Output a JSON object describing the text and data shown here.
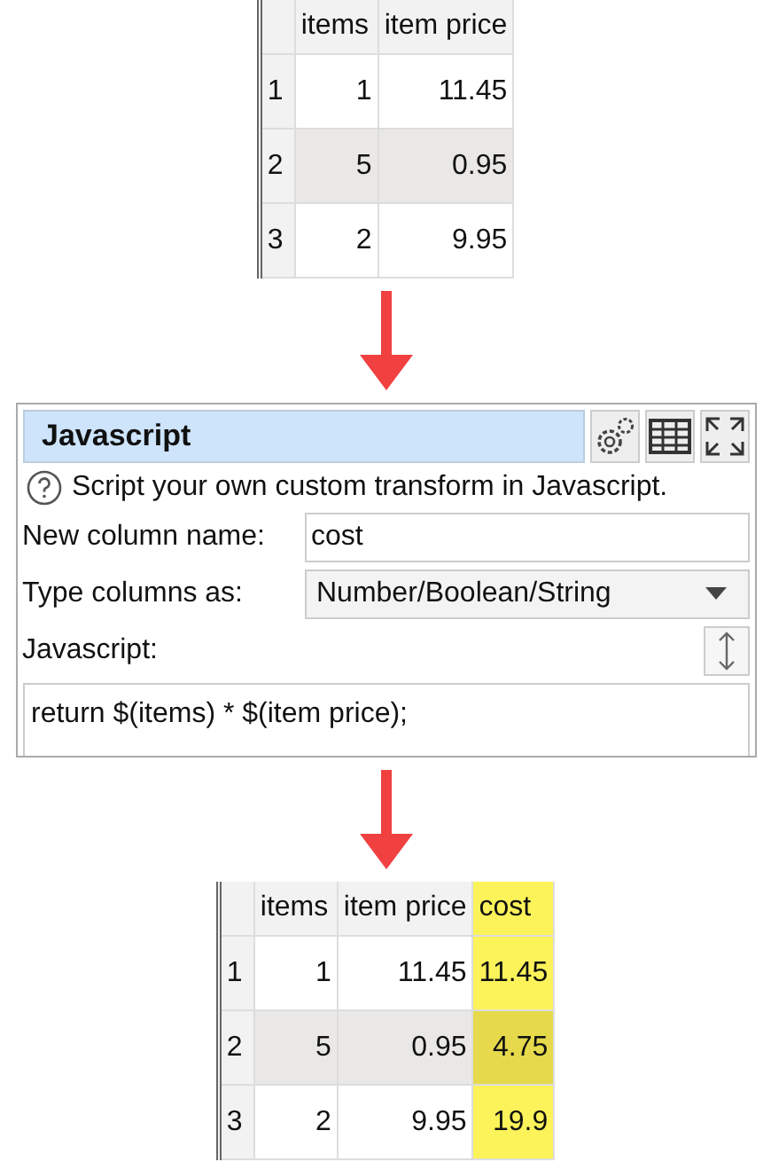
{
  "input_table": {
    "columns": [
      {
        "label": "items",
        "highlighted": false
      },
      {
        "label": "item price",
        "highlighted": false
      }
    ],
    "rows": [
      {
        "number": "1",
        "cells": [
          "1",
          "11.45"
        ]
      },
      {
        "number": "2",
        "cells": [
          "5",
          "0.95"
        ]
      },
      {
        "number": "3",
        "cells": [
          "2",
          "9.95"
        ]
      }
    ]
  },
  "panel": {
    "title": "Javascript",
    "help": "Script your own custom transform in Javascript.",
    "fields": [
      {
        "kind": "text",
        "label": "New column name:",
        "value": "cost"
      },
      {
        "kind": "dropdown",
        "label": "Type columns as:",
        "value": "Number/Boolean/String"
      }
    ],
    "code_label": "Javascript:",
    "code": "return $(items) * $(item price);"
  },
  "output_table": {
    "columns": [
      {
        "label": "items",
        "highlighted": false
      },
      {
        "label": "item price",
        "highlighted": false
      },
      {
        "label": "cost",
        "highlighted": true
      }
    ],
    "rows": [
      {
        "number": "1",
        "cells": [
          "1",
          "11.45",
          "11.45"
        ]
      },
      {
        "number": "2",
        "cells": [
          "5",
          "0.95",
          "4.75"
        ]
      },
      {
        "number": "3",
        "cells": [
          "2",
          "9.95",
          "19.9"
        ]
      }
    ]
  }
}
